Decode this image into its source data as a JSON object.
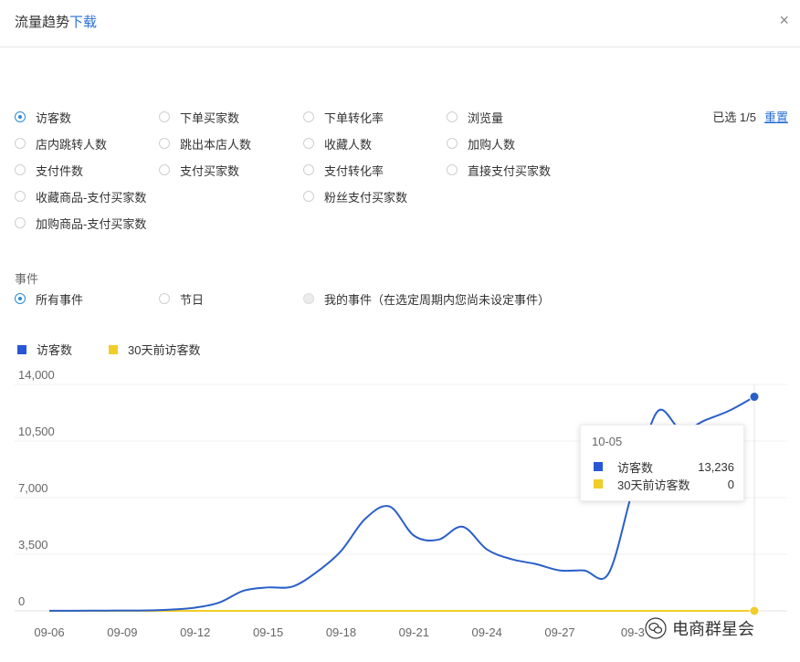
{
  "header": {
    "title": "流量趋势",
    "download": "下载",
    "close": "×"
  },
  "metrics": {
    "items": [
      {
        "label": "访客数",
        "checked": true
      },
      {
        "label": "下单买家数",
        "checked": false
      },
      {
        "label": "下单转化率",
        "checked": false
      },
      {
        "label": "浏览量",
        "checked": false
      },
      {
        "label": "店内跳转人数",
        "checked": false
      },
      {
        "label": "跳出本店人数",
        "checked": false
      },
      {
        "label": "收藏人数",
        "checked": false
      },
      {
        "label": "加购人数",
        "checked": false
      },
      {
        "label": "支付件数",
        "checked": false
      },
      {
        "label": "支付买家数",
        "checked": false
      },
      {
        "label": "支付转化率",
        "checked": false
      },
      {
        "label": "直接支付买家数",
        "checked": false
      },
      {
        "label": "收藏商品-支付买家数",
        "checked": false
      },
      {
        "label": "粉丝支付买家数",
        "checked": false
      },
      {
        "label": "加购商品-支付买家数",
        "checked": false
      }
    ],
    "selected_count": "已选 1/5",
    "reset": "重置"
  },
  "events": {
    "label": "事件",
    "options": [
      {
        "label": "所有事件",
        "checked": true,
        "disabled": false
      },
      {
        "label": "节日",
        "checked": false,
        "disabled": false
      },
      {
        "label": "我的事件（在选定周期内您尚未设定事件）",
        "checked": false,
        "disabled": true
      }
    ]
  },
  "colors": {
    "visitors": "#2a5fc9",
    "visitors_30d": "#f1cd28",
    "legend_visitors": "#2757d6"
  },
  "chart_data": {
    "type": "line",
    "x": [
      "09-06",
      "09-07",
      "09-08",
      "09-09",
      "09-10",
      "09-11",
      "09-12",
      "09-13",
      "09-14",
      "09-15",
      "09-16",
      "09-17",
      "09-18",
      "09-19",
      "09-20",
      "09-21",
      "09-22",
      "09-23",
      "09-24",
      "09-25",
      "09-26",
      "09-27",
      "09-28",
      "09-29",
      "09-30",
      "10-01",
      "10-02",
      "10-03",
      "10-04",
      "10-05"
    ],
    "x_tick_labels": [
      "09-06",
      "09-09",
      "09-12",
      "09-15",
      "09-18",
      "09-21",
      "09-24",
      "09-27",
      "09-3"
    ],
    "y_ticks": [
      {
        "value": 0,
        "label": "0"
      },
      {
        "value": 3500,
        "label": "3,500"
      },
      {
        "value": 7000,
        "label": "7,000"
      },
      {
        "value": 10500,
        "label": "10,500"
      },
      {
        "value": 14000,
        "label": "14,000"
      }
    ],
    "ylim": [
      0,
      14000
    ],
    "grid": true,
    "legend_position": "top-left",
    "series": [
      {
        "name": "访客数",
        "values": [
          10,
          10,
          15,
          20,
          30,
          80,
          200,
          520,
          1250,
          1450,
          1500,
          2400,
          3700,
          5700,
          6450,
          4650,
          4400,
          5200,
          3800,
          3200,
          2900,
          2500,
          2500,
          2300,
          7500,
          12300,
          11200,
          11800,
          12400,
          13236
        ]
      },
      {
        "name": "30天前访客数",
        "values": [
          0,
          0,
          0,
          0,
          0,
          0,
          0,
          0,
          0,
          0,
          0,
          0,
          0,
          0,
          0,
          0,
          0,
          0,
          0,
          0,
          0,
          0,
          0,
          0,
          0,
          0,
          0,
          0,
          0,
          0
        ]
      }
    ],
    "tooltip": {
      "date": "10-05",
      "rows": [
        {
          "name": "访客数",
          "value": "13,236"
        },
        {
          "name": "30天前访客数",
          "value": "0"
        }
      ]
    }
  },
  "watermark": "电商群星会"
}
